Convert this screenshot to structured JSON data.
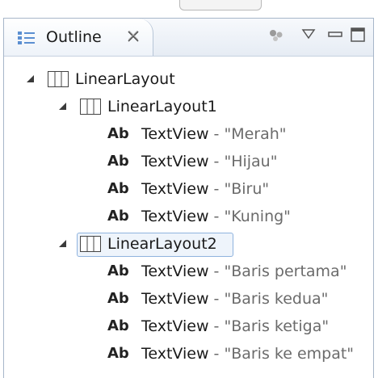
{
  "tab": {
    "title": "Outline"
  },
  "tree": {
    "root": {
      "label": "LinearLayout"
    },
    "groups": [
      {
        "label": "LinearLayout1",
        "children": [
          {
            "type_label": "Ab",
            "name": "TextView",
            "separator": " - ",
            "value": "\"Merah\""
          },
          {
            "type_label": "Ab",
            "name": "TextView",
            "separator": " - ",
            "value": "\"Hijau\""
          },
          {
            "type_label": "Ab",
            "name": "TextView",
            "separator": " - ",
            "value": "\"Biru\""
          },
          {
            "type_label": "Ab",
            "name": "TextView",
            "separator": " - ",
            "value": "\"Kuning\""
          }
        ]
      },
      {
        "label": "LinearLayout2",
        "selected": true,
        "children": [
          {
            "type_label": "Ab",
            "name": "TextView",
            "separator": " - ",
            "value": "\"Baris pertama\""
          },
          {
            "type_label": "Ab",
            "name": "TextView",
            "separator": " - ",
            "value": "\"Baris kedua\""
          },
          {
            "type_label": "Ab",
            "name": "TextView",
            "separator": " - ",
            "value": "\"Baris ketiga\""
          },
          {
            "type_label": "Ab",
            "name": "TextView",
            "separator": " - ",
            "value": "\"Baris ke empat\""
          }
        ]
      }
    ]
  },
  "colors": {
    "value_text": "#6b6b6b",
    "selection_border": "#8fb3de",
    "frame_border": "#a7b6c9"
  }
}
